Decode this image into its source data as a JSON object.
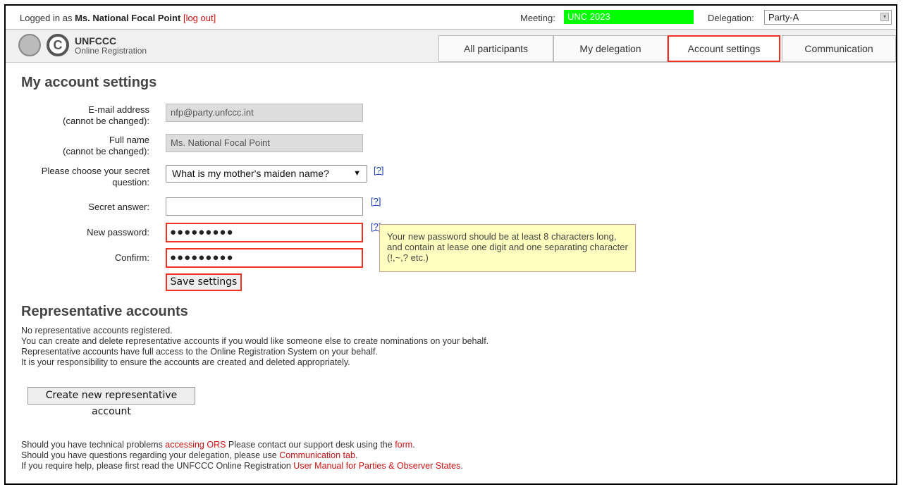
{
  "topbar": {
    "logged_in_prefix": "Logged in as",
    "user_name": "Ms. National Focal Point",
    "logout_label": "[log out]",
    "meeting_label": "Meeting:",
    "meeting_value": "UNC 2023",
    "delegation_label": "Delegation:",
    "delegation_value": "Party-A"
  },
  "brand": {
    "title": "UNFCCC",
    "subtitle": "Online Registration"
  },
  "tabs": [
    {
      "label": "All participants"
    },
    {
      "label": "My delegation"
    },
    {
      "label": "Account settings",
      "active": true
    },
    {
      "label": "Communication"
    }
  ],
  "settings": {
    "heading": "My account settings",
    "email_label_1": "E-mail address",
    "email_label_2": "(cannot be changed):",
    "email_value": "nfp@party.unfccc.int",
    "name_label_1": "Full name",
    "name_label_2": "(cannot be changed):",
    "name_value": "Ms. National Focal Point",
    "question_label_1": "Please choose your secret",
    "question_label_2": "question:",
    "question_value": "What is my mother's maiden name?",
    "answer_label": "Secret answer:",
    "new_password_label": "New password:",
    "new_password_value": "●●●●●●●●●",
    "confirm_label": "Confirm:",
    "confirm_value": "●●●●●●●●●",
    "help_label": "[?]",
    "tooltip": "Your new password should be at least 8 characters long, and contain at lease one digit and one separating character (!,~,? etc.)",
    "save_label": "Save settings"
  },
  "representative": {
    "heading": "Representative accounts",
    "lines": [
      "No representative accounts registered.",
      "You can create and delete representative accounts if you would like someone else to create nominations on your behalf.",
      "Representative accounts have full access to the Online Registration System on your behalf.",
      "It is your responsibility to ensure the accounts are created and deleted appropriately."
    ],
    "create_label": "Create new representative account"
  },
  "footer": {
    "l1_a": "Should you have technical problems ",
    "l1_link": "accessing ORS",
    "l1_b": " Please contact our support desk using the ",
    "l1_link2": "form",
    "l1_c": ".",
    "l2_a": "Should you have questions regarding your delegation, please use ",
    "l2_link": "Communication tab",
    "l2_b": ".",
    "l3_a": "If you require help, please first read the UNFCCC Online Registration ",
    "l3_link": "User Manual for Parties & Observer States",
    "l3_b": "."
  },
  "colors": {
    "accent_red": "#e32",
    "meeting_bg": "#00ff00",
    "link": "#c11",
    "help_link": "#1a3bb3",
    "tooltip_bg": "#ffffc0"
  }
}
